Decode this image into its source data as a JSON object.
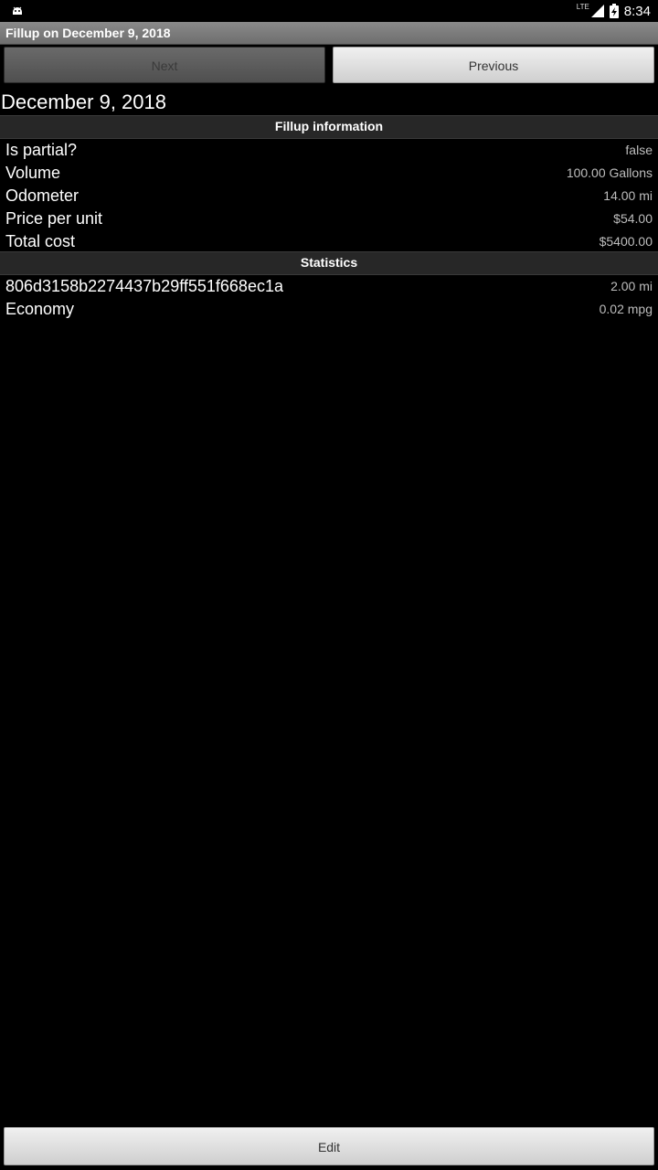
{
  "status": {
    "network": "LTE",
    "time": "8:34"
  },
  "title": "Fillup on December 9, 2018",
  "nav": {
    "next_label": "Next",
    "previous_label": "Previous"
  },
  "date": "December 9, 2018",
  "fillup_info": {
    "header": "Fillup information",
    "rows": [
      {
        "label": "Is partial?",
        "value": "false"
      },
      {
        "label": "Volume",
        "value": "100.00 Gallons"
      },
      {
        "label": "Odometer",
        "value": "14.00 mi"
      },
      {
        "label": "Price per unit",
        "value": "$54.00"
      },
      {
        "label": "Total cost",
        "value": "$5400.00"
      }
    ]
  },
  "statistics": {
    "header": "Statistics",
    "rows": [
      {
        "label": "806d3158b2274437b29ff551f668ec1a",
        "value": "2.00 mi"
      },
      {
        "label": "Economy",
        "value": "0.02 mpg"
      }
    ]
  },
  "edit_label": "Edit"
}
